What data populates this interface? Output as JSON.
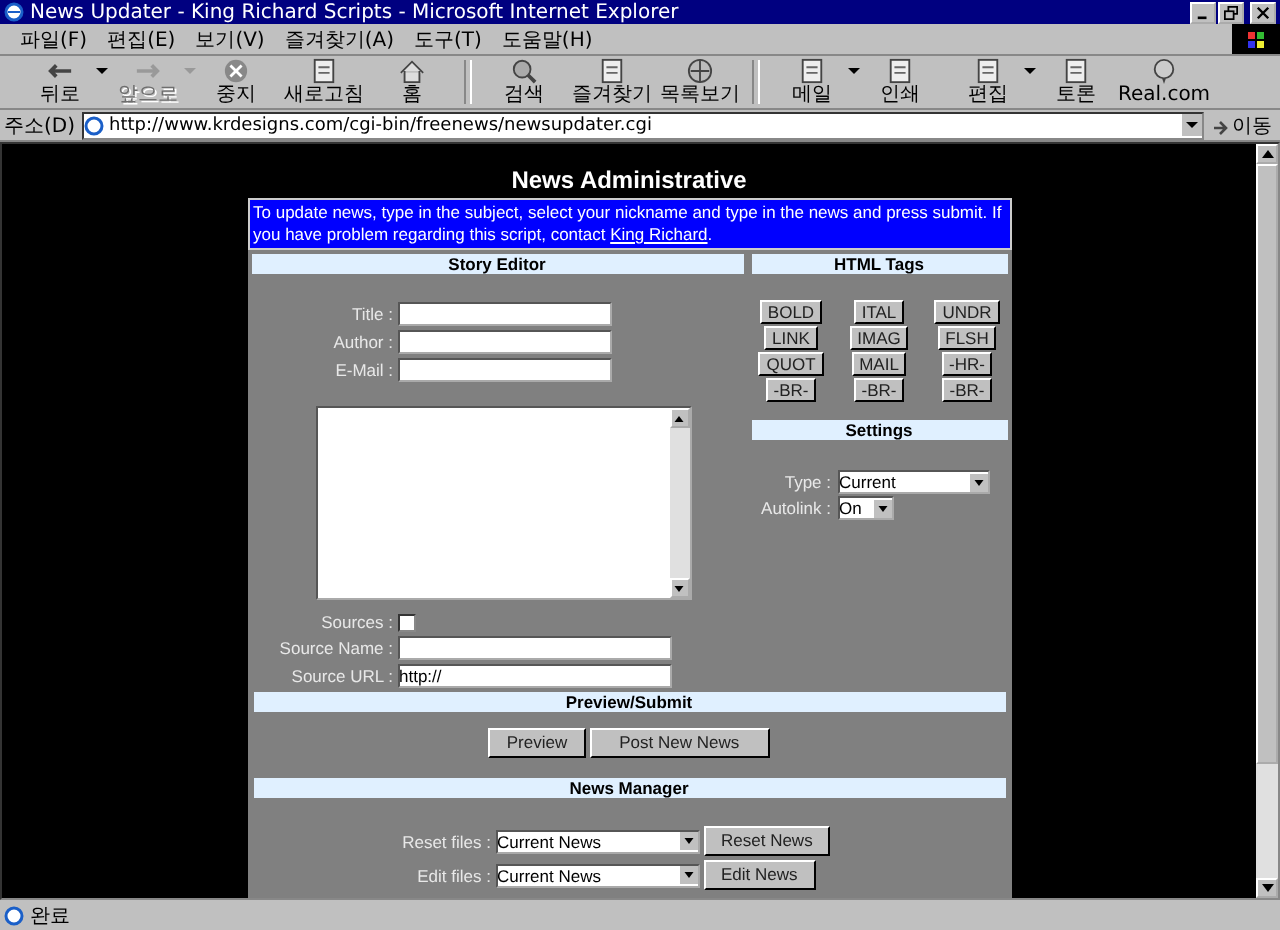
{
  "window": {
    "title": "News Updater - King Richard Scripts - Microsoft Internet Explorer"
  },
  "menu": [
    "파일(F)",
    "편집(E)",
    "보기(V)",
    "즐겨찾기(A)",
    "도구(T)",
    "도움말(H)"
  ],
  "toolbar": [
    {
      "label": "뒤로",
      "disabled": false,
      "dropdown": true
    },
    {
      "label": "앞으로",
      "disabled": true,
      "dropdown": true
    },
    {
      "label": "중지",
      "disabled": false,
      "dropdown": false
    },
    {
      "label": "새로고침",
      "disabled": false,
      "dropdown": false
    },
    {
      "label": "홈",
      "disabled": false,
      "dropdown": false
    },
    {
      "label": "검색",
      "disabled": false,
      "dropdown": false
    },
    {
      "label": "즐겨찾기",
      "disabled": false,
      "dropdown": false
    },
    {
      "label": "목록보기",
      "disabled": false,
      "dropdown": false
    },
    {
      "label": "메일",
      "disabled": false,
      "dropdown": true
    },
    {
      "label": "인쇄",
      "disabled": false,
      "dropdown": false
    },
    {
      "label": "편집",
      "disabled": false,
      "dropdown": true
    },
    {
      "label": "토론",
      "disabled": false,
      "dropdown": false
    },
    {
      "label": "Real.com",
      "disabled": false,
      "dropdown": false
    }
  ],
  "address_bar": {
    "label": "주소(D)",
    "url": "http://www.krdesigns.com/cgi-bin/freenews/newsupdater.cgi",
    "go": "이동"
  },
  "page": {
    "heading": "News Administrative",
    "intro": "To update news, type in the subject, select your nickname and type in the news and press submit. If you have problem regarding this script, contact ",
    "intro_link": "King Richard",
    "intro_end": ".",
    "story_editor": {
      "header": "Story Editor",
      "fields": [
        {
          "label": "Title :"
        },
        {
          "label": "Author :"
        },
        {
          "label": "E-Mail :"
        }
      ],
      "sources": {
        "label": "Sources :",
        "checked": false
      },
      "source_fields": [
        {
          "label": "Source Name :"
        },
        {
          "label": "Source URL :",
          "value": "http://"
        }
      ]
    },
    "html_tags": {
      "header": "HTML Tags",
      "buttons": [
        "BOLD",
        "ITAL",
        "UNDR",
        "LINK",
        "IMAG",
        "FLSH",
        "QUOT",
        "MAIL",
        "-HR-",
        "-BR-",
        "-BR-",
        "-BR-"
      ]
    },
    "settings": {
      "header": "Settings",
      "type": {
        "label": "Type :",
        "value": "Current"
      },
      "autolink": {
        "label": "Autolink :",
        "value": "On"
      }
    },
    "preview_submit": {
      "header": "Preview/Submit",
      "buttons": [
        "Preview",
        "Post New News"
      ]
    },
    "news_manager": {
      "header": "News Manager",
      "rows": [
        {
          "label": "Reset files :",
          "value": "Current News",
          "button": "Reset News"
        },
        {
          "label": "Edit files :",
          "value": "Current News",
          "button": "Edit News"
        }
      ]
    }
  },
  "status_bar": {
    "text": "완료"
  }
}
